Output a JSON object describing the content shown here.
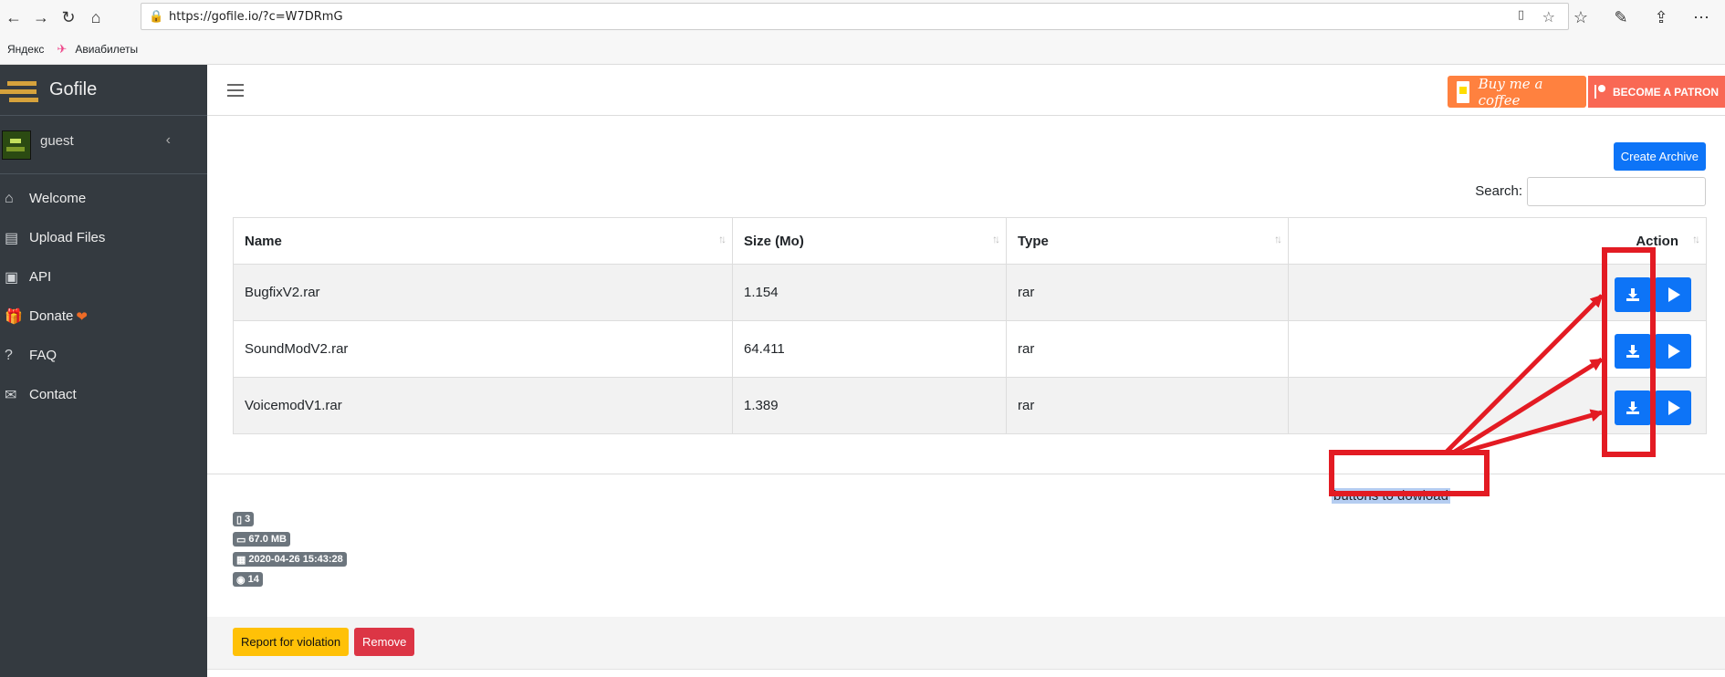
{
  "browser": {
    "address": "https://gofile.io/?c=W7DRmG",
    "bookmarks": [
      "Яндекс",
      "Авиабилеты"
    ]
  },
  "sidebar": {
    "brand": "Gofile",
    "username": "guest",
    "items": [
      {
        "label": "Welcome",
        "icon": "home-icon"
      },
      {
        "label": "Upload Files",
        "icon": "file-upload-icon"
      },
      {
        "label": "API",
        "icon": "code-icon"
      },
      {
        "label": "Donate",
        "icon": "gift-icon"
      },
      {
        "label": "FAQ",
        "icon": "question-icon"
      },
      {
        "label": "Contact",
        "icon": "envelope-icon"
      }
    ]
  },
  "header": {
    "coffee_label": "Buy me a coffee",
    "patron_label": "BECOME A PATRON"
  },
  "toolbar": {
    "create_label": "Create Archive",
    "search_label": "Search:",
    "search_value": ""
  },
  "table": {
    "columns": [
      "Name",
      "Size (Mo)",
      "Type",
      "Action"
    ],
    "rows": [
      {
        "name": "BugfixV2.rar",
        "size": "1.154",
        "type": "rar"
      },
      {
        "name": "SoundModV2.rar",
        "size": "64.411",
        "type": "rar"
      },
      {
        "name": "VoicemodV1.rar",
        "size": "1.389",
        "type": "rar"
      }
    ]
  },
  "annotation": {
    "text": "buttons to dowload",
    "color": "#e31b23"
  },
  "info": {
    "files": "3",
    "size": "67.0 MB",
    "date": "2020-04-26 15:43:28",
    "views": "14"
  },
  "footer": {
    "report_label": "Report for violation",
    "remove_label": "Remove"
  },
  "colors": {
    "primary": "#0d74f7",
    "sidebar": "#343a40",
    "warning": "#ffc107",
    "danger": "#dc3545"
  }
}
